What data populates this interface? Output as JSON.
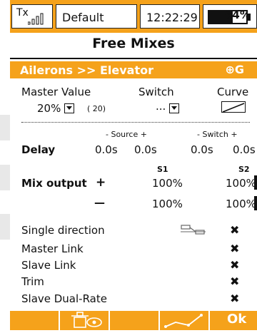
{
  "status_bar": {
    "tx_label": "Tx",
    "model_name": "Default",
    "time": "12:22:29",
    "battery": "64%",
    "battery_level": 0.64,
    "accent_color": "#f5a21b"
  },
  "page": {
    "title": "Free Mixes",
    "mix_name": "Ailerons >> Elevator",
    "mix_icon": "⊕G"
  },
  "master": {
    "master_label": "Master Value",
    "switch_label": "Switch",
    "curve_label": "Curve",
    "value": "20%",
    "value_paren": "( 20)",
    "switch_value": "..."
  },
  "delay": {
    "source_header": "- Source +",
    "switch_header": "- Switch +",
    "label": "Delay",
    "values": [
      "0.0s",
      "0.0s",
      "0.0s",
      "0.0s"
    ]
  },
  "mix_output": {
    "s1_header": "S1",
    "s2_header": "S2",
    "label": "Mix output",
    "plus_sign": "+",
    "minus_sign": "—",
    "plus_values": [
      "100%",
      "100%"
    ],
    "minus_values": [
      "100%",
      "100%"
    ]
  },
  "options": [
    {
      "label": "Single direction",
      "value": "✖"
    },
    {
      "label": "Master Link",
      "value": "✖"
    },
    {
      "label": "Slave Link",
      "value": "✖"
    },
    {
      "label": "Trim",
      "value": "✖"
    },
    {
      "label": "Slave Dual-Rate",
      "value": "✖"
    }
  ],
  "bottom_bar": {
    "ok_label": "Ok",
    "icons": [
      "lock-eye-icon",
      "curve-icon"
    ]
  }
}
